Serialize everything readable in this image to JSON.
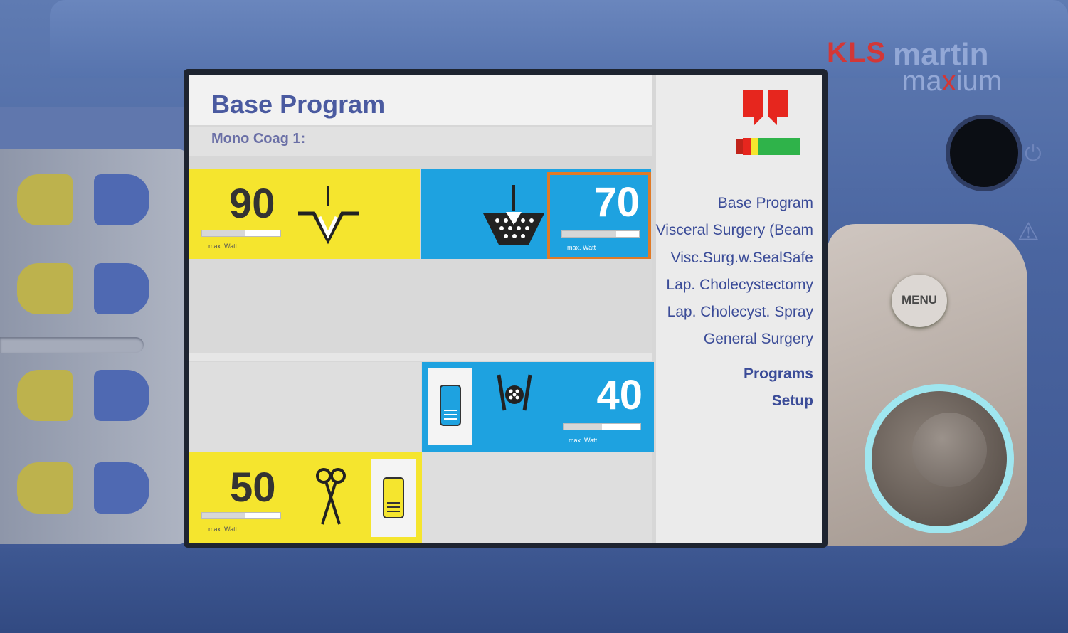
{
  "brand": {
    "kls": "KLS",
    "martin": "martin",
    "maxium_pre": "ma",
    "maxium_x": "x",
    "maxium_post": "ium"
  },
  "screen": {
    "title": "Base Program",
    "subtitle": "Mono Coag 1:",
    "channels": {
      "top_yellow": {
        "value": "90",
        "max_label": "max. Watt",
        "level": 0.55
      },
      "top_blue": {
        "value": "70",
        "max_label": "max. Watt",
        "level": 0.7
      },
      "bottom_blue": {
        "value": "40",
        "max_label": "max. Watt",
        "level": 0.5
      },
      "bottom_yellow": {
        "value": "50",
        "max_label": "max. Watt",
        "level": 0.55
      }
    },
    "program_list": [
      "Base Program",
      "Visceral Surgery (Beam",
      "Visc.Surg.w.SealSafe",
      "Lap. Cholecystectomy",
      "Lap. Cholecyst. Spray",
      "General Surgery"
    ],
    "menu_links": {
      "programs": "Programs",
      "setup": "Setup"
    }
  },
  "hardware": {
    "menu_button": "MENU"
  },
  "colors": {
    "yellow": "#f5e52e",
    "blue": "#1ea2e0",
    "title": "#4a5aa0",
    "selected_border": "#e07a26"
  }
}
